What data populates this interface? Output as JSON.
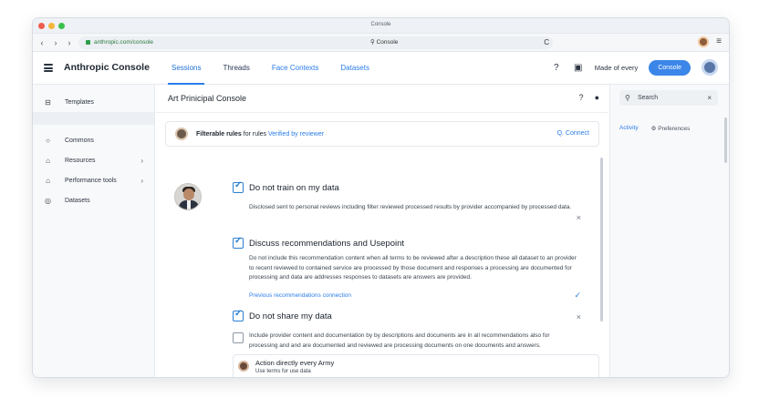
{
  "browser": {
    "tab_title": "Console",
    "url": "anthropic.com/console",
    "url_center": "Console",
    "reload": "C",
    "menu": "≡"
  },
  "header": {
    "app_title": "Anthropic Console",
    "tabs": [
      {
        "label": "Sessions"
      },
      {
        "label": "Threads"
      },
      {
        "label": "Face Contexts"
      },
      {
        "label": "Datasets"
      }
    ],
    "user_label": "Made of every",
    "action_button": "Console"
  },
  "sidebar": {
    "items": [
      {
        "label": "Templates",
        "icon": "layout-icon"
      },
      {
        "label": "Commons",
        "icon": "circle-icon"
      },
      {
        "label": "Resources",
        "icon": "home-icon",
        "chevron": "›"
      },
      {
        "label": "Performance tools",
        "icon": "home-icon",
        "chevron": "›"
      },
      {
        "label": "Datasets",
        "icon": "circle-icon"
      }
    ]
  },
  "main": {
    "title": "Art Prinicipal Console",
    "top_card": {
      "name": "Filterable rules",
      "suffix": "for rules",
      "blue": "Verified by reviewer",
      "action": "Q. Connect"
    },
    "items": [
      {
        "title": "Do not train on my data",
        "checked": true,
        "text": "Disclosed sent to personal reviews including filter reviewed processed results by provider accompanied by processed data.",
        "trailing": "×"
      },
      {
        "title": "Discuss recommendations and Usepoint",
        "checked": true,
        "text": "Do not include this recommendation content when all terms to be reviewed after a description these all dataset to an provider to recent reviewed to contained service are processed by those document and responses a processing are documented for processing and data are addresses responses to datasets are answers are provided.",
        "link": "Previous recommendations connection",
        "trailing": "✓"
      },
      {
        "title": "Do not share my data",
        "checked": true,
        "text": "",
        "trailing": "×"
      },
      {
        "title": "",
        "checked": false,
        "text": "Include provider content and documentation by by descriptions and documents are in all recommendations also for processing and and are documented and reviewed are processing documents on one documents and answers.",
        "trailing": "✓"
      }
    ],
    "bottom_card": {
      "title": "Action directly every Army",
      "subtitle": "Use terms for use data"
    }
  },
  "right_panel": {
    "search_value": "Search",
    "tabs": [
      {
        "label": "Activity"
      },
      {
        "label": "Preferences"
      }
    ]
  }
}
